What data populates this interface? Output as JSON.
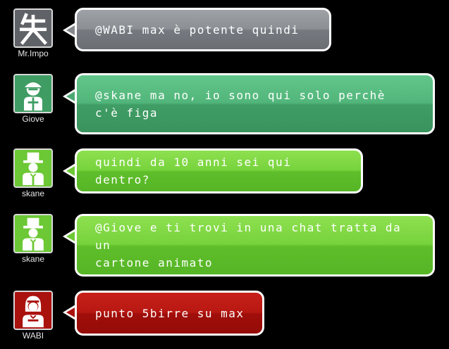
{
  "messages": [
    {
      "user": "Mr.Impo",
      "avatar_icon": "kanji-avatar-icon",
      "avatar_color": "#6b6f74",
      "text": "@WABI max è potente quindi",
      "bubble_color": "#8c9095"
    },
    {
      "user": "Giove",
      "avatar_icon": "cap-person-avatar-icon",
      "avatar_color": "#3f9d64",
      "text_lines": [
        "@skane ma no, io sono qui solo perchè",
        "c'è figa"
      ],
      "bubble_color": "#52b67b"
    },
    {
      "user": "skane",
      "avatar_icon": "top-hat-person-avatar-icon",
      "avatar_color": "#6cc834",
      "text": "quindi da 10 anni sei qui dentro?",
      "bubble_color": "#77d33c"
    },
    {
      "user": "skane",
      "avatar_icon": "top-hat-person-avatar-icon",
      "avatar_color": "#6cc834",
      "text_lines": [
        "@Giove e ti trovi in una chat tratta da un",
        "cartone animato"
      ],
      "bubble_color": "#77d33c"
    },
    {
      "user": "WABI",
      "avatar_icon": "girl-avatar-icon",
      "avatar_color": "#aa120e",
      "text": "punto 5birre su max",
      "bubble_color": "#b81812"
    }
  ]
}
